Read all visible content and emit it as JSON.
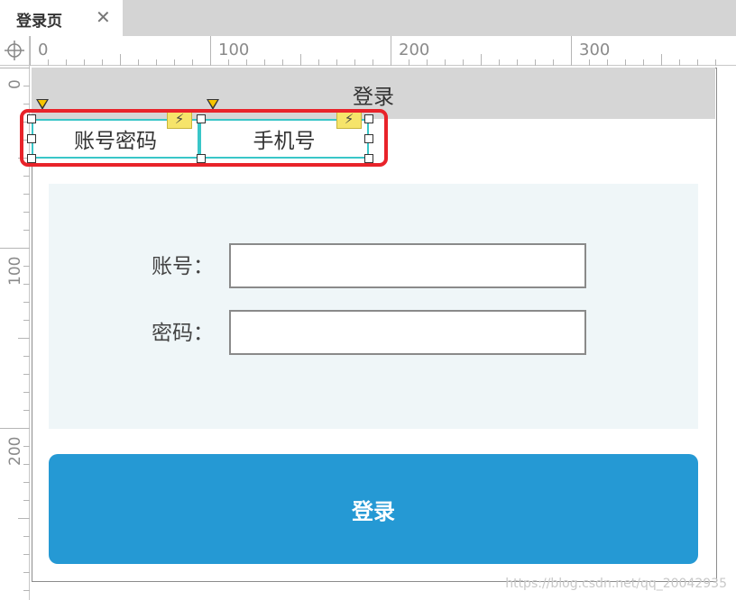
{
  "tab": {
    "title": "登录页",
    "close_glyph": "✕"
  },
  "rulers": {
    "horizontal": [
      "0",
      "100",
      "200",
      "300"
    ],
    "vertical": [
      "0",
      "100",
      "200"
    ]
  },
  "screen": {
    "header_title": "登录",
    "segment_tabs": [
      {
        "label": "账号密码"
      },
      {
        "label": "手机号"
      }
    ],
    "form": {
      "account_label": "账号：",
      "account_value": "",
      "password_label": "密码：",
      "password_value": ""
    },
    "login_button": "登录"
  },
  "watermark": "https://blog.csdn.net/qq_20042935",
  "colors": {
    "accent_button": "#2599d4",
    "selection_outline": "#e8232a",
    "segment_border": "#39c6c8",
    "panel_bg": "#eff6f8",
    "header_bg": "#d6d6d6"
  },
  "icons": [
    "close-icon",
    "crosshair-icon",
    "lightning-icon",
    "marker-triangle-icon"
  ]
}
